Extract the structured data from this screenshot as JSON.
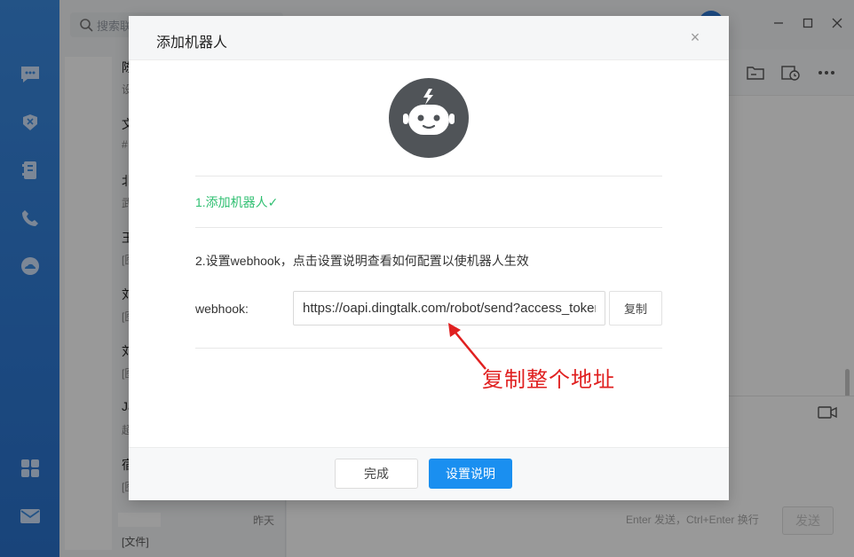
{
  "app": {
    "search_placeholder": "搜索联系",
    "window_controls": [
      "minimize",
      "maximize",
      "close"
    ]
  },
  "rail": {
    "icons": [
      "chat-icon",
      "workbench-icon",
      "contacts-icon",
      "phone-icon",
      "cloud-icon",
      "apps-icon",
      "mail-icon"
    ]
  },
  "conversations": [
    {
      "title": "陈",
      "snippet": "设"
    },
    {
      "title": "文",
      "snippet": "#"
    },
    {
      "title": "北",
      "snippet": "武"
    },
    {
      "title": "王",
      "snippet": "[图"
    },
    {
      "title": "刘",
      "snippet": "[图"
    },
    {
      "title": "刘",
      "snippet": "[图"
    },
    {
      "title": "Ja",
      "snippet": "超"
    },
    {
      "title": "宿",
      "snippet": "[图"
    }
  ],
  "last_conversation": {
    "time": "昨天",
    "snippet": "[文件]"
  },
  "chat": {
    "enter_hint": "Enter 发送，Ctrl+Enter 换行",
    "send_label": "发送"
  },
  "modal": {
    "title": "添加机器人",
    "close_glyph": "×",
    "step1": "1.添加机器人✓",
    "step2": "2.设置webhook，点击设置说明查看如何配置以使机器人生效",
    "webhook_label": "webhook:",
    "webhook_value": "https://oapi.dingtalk.com/robot/send?access_token=",
    "copy_label": "复制",
    "done_label": "完成",
    "doc_label": "设置说明"
  },
  "annotation": {
    "text": "复制整个地址",
    "color": "#e02020"
  },
  "colors": {
    "accent": "#1a8ff0",
    "success": "#2fbf71",
    "rail": "#2f7bd6"
  }
}
